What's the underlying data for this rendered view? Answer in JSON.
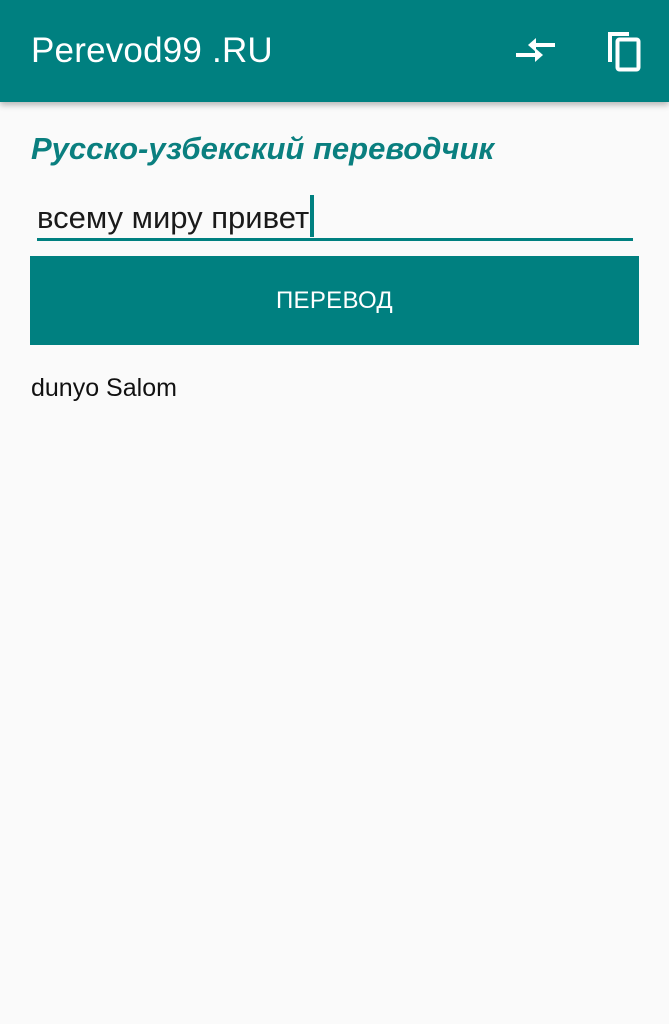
{
  "app_bar": {
    "title": "Perevod99 .RU",
    "actions": [
      {
        "icon": "swap-icon"
      },
      {
        "icon": "copy-icon"
      }
    ]
  },
  "main": {
    "heading": "Русско-узбекский переводчик",
    "input": {
      "value": "всему миру привет",
      "placeholder": ""
    },
    "translate_button_label": "ПЕРЕВОД",
    "result": "dunyo Salom"
  },
  "colors": {
    "primary": "#008080",
    "heading": "#0a7f7f",
    "background": "#fafafa",
    "on_primary": "#ffffff"
  }
}
